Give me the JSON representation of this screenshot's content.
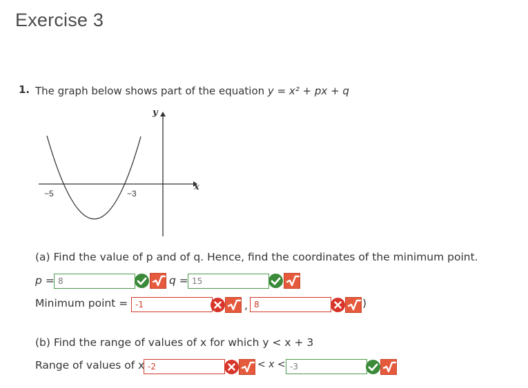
{
  "page": {
    "title": "Exercise 3"
  },
  "question": {
    "number": "1.",
    "text_prefix": "The graph below shows part of the equation ",
    "equation": "y = x² + px + q"
  },
  "graph": {
    "y_label": "y",
    "x_label": "x",
    "tick_left": "−5",
    "tick_right": "−3"
  },
  "part_a": {
    "prompt": "(a) Find the value of p and of q. Hence, find the coordinates of the minimum point.",
    "p_label": "p =",
    "p_value": "8",
    "p_status": "correct",
    "q_label": "q =",
    "q_value": "15",
    "q_status": "correct",
    "min_label": "Minimum point = (",
    "min_x_value": "-1",
    "min_x_status": "incorrect",
    "comma": ",",
    "min_y_value": "8",
    "min_y_status": "incorrect",
    "close_paren": ")"
  },
  "part_b": {
    "prompt": "(b) Find the range of values of x for which y < x + 3",
    "range_label": "Range of values of x:",
    "lower_value": "-2",
    "lower_status": "incorrect",
    "middle_text": "< x <",
    "upper_value": "-3",
    "upper_status": "correct"
  },
  "icons": {
    "correct": "check-circle-icon",
    "incorrect": "x-circle-icon",
    "math_input": "square-root-icon"
  },
  "colors": {
    "correct": "#3a8a3a",
    "incorrect": "#d8352a",
    "math_button": "#e55a3c"
  }
}
